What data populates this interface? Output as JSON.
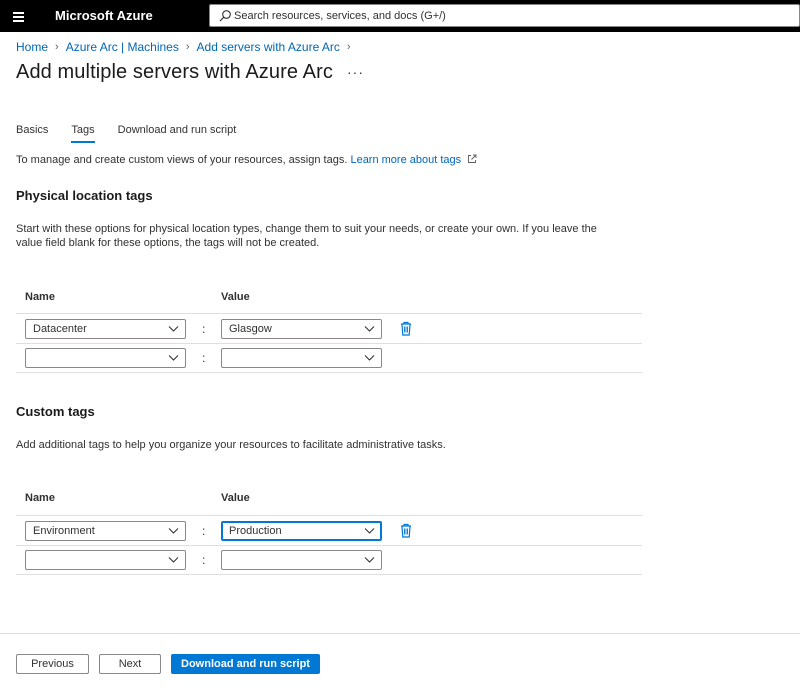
{
  "topbar": {
    "menu_icon": "hamburger-icon",
    "brand": "Microsoft Azure",
    "search_placeholder": "Search resources, services, and docs (G+/)",
    "search_icon": "search-icon"
  },
  "breadcrumb": [
    "Home",
    "Azure Arc | Machines",
    "Add servers with Azure Arc"
  ],
  "page": {
    "title": "Add multiple servers with Azure Arc",
    "more": "···"
  },
  "tabs": [
    {
      "label": "Basics",
      "active": false
    },
    {
      "label": "Tags",
      "active": true
    },
    {
      "label": "Download and run script",
      "active": false
    }
  ],
  "intro": {
    "text": "To manage and create custom views of your resources, assign tags.",
    "link": "Learn more about tags"
  },
  "physical": {
    "heading": "Physical location tags",
    "description": "Start with these options for physical location types, change them to suit your needs, or create your own. If you leave the value field blank for these options, the tags will not be created.",
    "name_header": "Name",
    "value_header": "Value",
    "rows": [
      {
        "name": "Datacenter",
        "value": "Glasgow"
      },
      {
        "name": "",
        "value": ""
      }
    ]
  },
  "custom": {
    "heading": "Custom tags",
    "description": "Add additional tags to help you organize your resources to facilitate administrative tasks.",
    "name_header": "Name",
    "value_header": "Value",
    "rows": [
      {
        "name": "Environment",
        "value": "Production"
      },
      {
        "name": "",
        "value": ""
      }
    ]
  },
  "separator": ":",
  "footer": {
    "previous": "Previous",
    "next": "Next",
    "download": "Download and run script"
  },
  "colors": {
    "accent": "#0078d4",
    "link": "#0067b8",
    "topbar": "#000000"
  }
}
